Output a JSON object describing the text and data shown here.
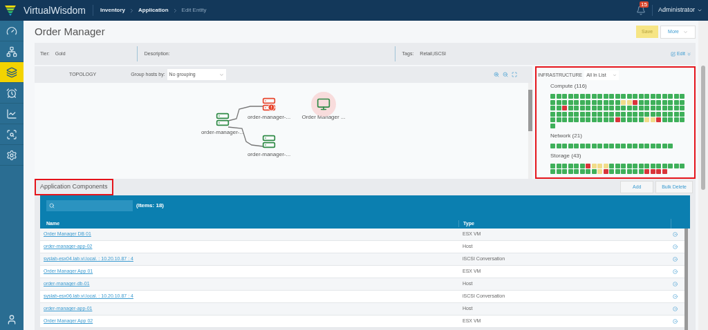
{
  "header": {
    "brand": "VirtualWisdom",
    "breadcrumb": [
      {
        "label": "Inventory",
        "current": false
      },
      {
        "label": "Application",
        "current": false
      },
      {
        "label": "Edit Entity",
        "current": true
      }
    ],
    "notifications": "15",
    "user": "Administrator"
  },
  "sidebar": {
    "items": [
      {
        "kind": "gauge",
        "selected": false
      },
      {
        "kind": "network",
        "selected": false
      },
      {
        "kind": "layers",
        "selected": true
      },
      {
        "kind": "alarm",
        "selected": false
      },
      {
        "kind": "trend",
        "selected": false
      },
      {
        "kind": "bars",
        "selected": false
      },
      {
        "kind": "settings",
        "selected": false
      }
    ],
    "user": {
      "kind": "user"
    }
  },
  "page": {
    "title": "Order Manager",
    "save": "Save",
    "more": "More"
  },
  "info": {
    "tier_label": "Tier:",
    "tier": "Gold",
    "description_label": "Description:",
    "tags_label": "Tags:",
    "tags": "Retail,iSCSI",
    "edit": "Edit"
  },
  "topology": {
    "title": "TOPOLOGY",
    "group_label": "Group hosts by:",
    "group_value": "No grouping",
    "nodes": [
      {
        "kind": "server",
        "color": "#2e8a45",
        "alert": false,
        "label": "order-manager-..."
      },
      {
        "kind": "server",
        "color": "#e8452c",
        "alert": true,
        "label": "order-manager-..."
      },
      {
        "kind": "server",
        "color": "#2e8a45",
        "alert": false,
        "label": "order-manager-..."
      },
      {
        "kind": "monitor",
        "color": "#2e8a45",
        "alert": false,
        "label": "Order Manager ..."
      }
    ]
  },
  "infrastructure": {
    "title": "INFRASTRUCTURE",
    "filter": "All In List",
    "groups": [
      {
        "name": "Compute (116)",
        "tiles": [
          {
            "color": "#3fb05a"
          },
          {
            "color": "#3fb05a"
          },
          {
            "color": "#3fb05a"
          },
          {
            "color": "#3fb05a"
          },
          {
            "color": "#3fb05a"
          },
          {
            "color": "#3fb05a"
          },
          {
            "color": "#3fb05a"
          },
          {
            "color": "#3fb05a"
          },
          {
            "color": "#3fb05a"
          },
          {
            "color": "#3fb05a"
          },
          {
            "color": "#3fb05a"
          },
          {
            "color": "#3fb05a"
          },
          {
            "color": "#3fb05a"
          },
          {
            "color": "#3fb05a"
          },
          {
            "color": "#3fb05a"
          },
          {
            "color": "#3fb05a"
          },
          {
            "color": "#3fb05a"
          },
          {
            "color": "#3fb05a"
          },
          {
            "color": "#3fb05a"
          },
          {
            "color": "#3fb05a"
          },
          {
            "color": "#3fb05a"
          },
          {
            "color": "#3fb05a"
          },
          {
            "color": "#3fb05a"
          },
          {
            "color": "#3fb05a"
          },
          {
            "color": "#3fb05a"
          },
          {
            "color": "#3fb05a"
          },
          {
            "color": "#3fb05a"
          },
          {
            "color": "#3fb05a"
          },
          {
            "color": "#3fb05a"
          },
          {
            "color": "#3fb05a"
          },
          {
            "color": "#3fb05a"
          },
          {
            "color": "#3fb05a"
          },
          {
            "color": "#3fb05a"
          },
          {
            "color": "#3fb05a"
          },
          {
            "color": "#3fb05a"
          },
          {
            "color": "#f1dc8a"
          },
          {
            "color": "#f1dc8a"
          },
          {
            "color": "#d9343a"
          },
          {
            "color": "#3fb05a"
          },
          {
            "color": "#3fb05a"
          },
          {
            "color": "#3fb05a"
          },
          {
            "color": "#3fb05a"
          },
          {
            "color": "#3fb05a"
          },
          {
            "color": "#3fb05a"
          },
          {
            "color": "#3fb05a"
          },
          {
            "color": "#3fb05a"
          },
          {
            "color": "#3fb05a"
          },
          {
            "color": "#3fb05a"
          },
          {
            "color": "#d9343a"
          },
          {
            "color": "#3fb05a"
          },
          {
            "color": "#3fb05a"
          },
          {
            "color": "#3fb05a"
          },
          {
            "color": "#3fb05a"
          },
          {
            "color": "#3fb05a"
          },
          {
            "color": "#3fb05a"
          },
          {
            "color": "#3fb05a"
          },
          {
            "color": "#3fb05a"
          },
          {
            "color": "#3fb05a"
          },
          {
            "color": "#3fb05a"
          },
          {
            "color": "#3fb05a"
          },
          {
            "color": "#3fb05a"
          },
          {
            "color": "#3fb05a"
          },
          {
            "color": "#3fb05a"
          },
          {
            "color": "#3fb05a"
          },
          {
            "color": "#3fb05a"
          },
          {
            "color": "#3fb05a"
          },
          {
            "color": "#3fb05a"
          },
          {
            "color": "#3fb05a"
          },
          {
            "color": "#3fb05a"
          },
          {
            "color": "#3fb05a"
          },
          {
            "color": "#3fb05a"
          },
          {
            "color": "#3fb05a"
          },
          {
            "color": "#3fb05a"
          },
          {
            "color": "#3fb05a"
          },
          {
            "color": "#3fb05a"
          },
          {
            "color": "#3fb05a"
          },
          {
            "color": "#3fb05a"
          },
          {
            "color": "#3fb05a"
          },
          {
            "color": "#3fb05a"
          },
          {
            "color": "#3fb05a"
          },
          {
            "color": "#3fb05a"
          },
          {
            "color": "#3fb05a"
          },
          {
            "color": "#3fb05a"
          },
          {
            "color": "#3fb05a"
          },
          {
            "color": "#3fb05a"
          },
          {
            "color": "#3fb05a"
          },
          {
            "color": "#3fb05a"
          },
          {
            "color": "#3fb05a"
          },
          {
            "color": "#3fb05a"
          },
          {
            "color": "#3fb05a"
          },
          {
            "color": "#3fb05a"
          },
          {
            "color": "#3fb05a"
          },
          {
            "color": "#3fb05a"
          },
          {
            "color": "#3fb05a"
          },
          {
            "color": "#3fb05a"
          },
          {
            "color": "#3fb05a"
          },
          {
            "color": "#3fb05a"
          },
          {
            "color": "#3fb05a"
          },
          {
            "color": "#3fb05a"
          },
          {
            "color": "#3fb05a"
          },
          {
            "color": "#3fb05a"
          },
          {
            "color": "#3fb05a"
          },
          {
            "color": "#3fb05a"
          },
          {
            "color": "#d9343a"
          },
          {
            "color": "#3fb05a"
          },
          {
            "color": "#3fb05a"
          },
          {
            "color": "#3fb05a"
          },
          {
            "color": "#3fb05a"
          },
          {
            "color": "#f1dc8a"
          },
          {
            "color": "#f1dc8a"
          },
          {
            "color": "#d9343a"
          },
          {
            "color": "#3fb05a"
          },
          {
            "color": "#3fb05a"
          },
          {
            "color": "#3fb05a"
          },
          {
            "color": "#3fb05a"
          },
          {
            "color": "#3fb05a"
          }
        ]
      },
      {
        "name": "Network (21)",
        "tiles": [
          {
            "color": "#3fb05a"
          },
          {
            "color": "#3fb05a"
          },
          {
            "color": "#3fb05a"
          },
          {
            "color": "#3fb05a"
          },
          {
            "color": "#3fb05a"
          },
          {
            "color": "#3fb05a"
          },
          {
            "color": "#3fb05a"
          },
          {
            "color": "#3fb05a"
          },
          {
            "color": "#3fb05a"
          },
          {
            "color": "#3fb05a"
          },
          {
            "color": "#3fb05a"
          },
          {
            "color": "#3fb05a"
          },
          {
            "color": "#3fb05a"
          },
          {
            "color": "#3fb05a"
          },
          {
            "color": "#3fb05a"
          },
          {
            "color": "#3fb05a"
          },
          {
            "color": "#3fb05a"
          },
          {
            "color": "#3fb05a"
          },
          {
            "color": "#3fb05a"
          },
          {
            "color": "#3fb05a"
          },
          {
            "color": "#3fb05a"
          }
        ]
      },
      {
        "name": "Storage (43)",
        "tiles": [
          {
            "color": "#3fb05a"
          },
          {
            "color": "#3fb05a"
          },
          {
            "color": "#3fb05a"
          },
          {
            "color": "#3fb05a"
          },
          {
            "color": "#3fb05a"
          },
          {
            "color": "#3fb05a"
          },
          {
            "color": "#d9343a"
          },
          {
            "color": "#f1dc8a"
          },
          {
            "color": "#f1dc8a"
          },
          {
            "color": "#f1dc8a"
          },
          {
            "color": "#3fb05a"
          },
          {
            "color": "#3fb05a"
          },
          {
            "color": "#3fb05a"
          },
          {
            "color": "#3fb05a"
          },
          {
            "color": "#3fb05a"
          },
          {
            "color": "#3fb05a"
          },
          {
            "color": "#3fb05a"
          },
          {
            "color": "#3fb05a"
          },
          {
            "color": "#3fb05a"
          },
          {
            "color": "#3fb05a"
          },
          {
            "color": "#3fb05a"
          },
          {
            "color": "#3fb05a"
          },
          {
            "color": "#3fb05a"
          },
          {
            "color": "#3fb05a"
          },
          {
            "color": "#3fb05a"
          },
          {
            "color": "#3fb05a"
          },
          {
            "color": "#3fb05a"
          },
          {
            "color": "#3fb05a"
          },
          {
            "color": "#3fb05a"
          },
          {
            "color": "#3fb05a"
          },
          {
            "color": "#3fb05a"
          },
          {
            "color": "#f1dc8a"
          },
          {
            "color": "#d9343a"
          },
          {
            "color": "#3fb05a"
          },
          {
            "color": "#3fb05a"
          },
          {
            "color": "#3fb05a"
          },
          {
            "color": "#3fb05a"
          },
          {
            "color": "#3fb05a"
          },
          {
            "color": "#3fb05a"
          },
          {
            "color": "#d9343a"
          },
          {
            "color": "#d9343a"
          },
          {
            "color": "#d9343a"
          },
          {
            "color": "#d9343a"
          }
        ]
      }
    ]
  },
  "components": {
    "title": "Application Components",
    "add": "Add",
    "bulk_delete": "Bulk Delete",
    "count": "(Items: 18)",
    "columns": [
      "Name",
      "Type"
    ],
    "rows": [
      {
        "name": "Order Manager DB 01",
        "type": "ESX VM"
      },
      {
        "name": "order-manager-app-02",
        "type": "Host"
      },
      {
        "name": "syslab-esx04.lab.vi.local. : 10.20.10.87 : 4",
        "type": "iSCSI Conversation"
      },
      {
        "name": "Order Manager App 01",
        "type": "ESX VM"
      },
      {
        "name": "order-manager-db-01",
        "type": "Host"
      },
      {
        "name": "syslab-esx06.lab.vi.local. : 10.20.10.87 : 4",
        "type": "iSCSI Conversation"
      },
      {
        "name": "order-manager-app-01",
        "type": "Host"
      },
      {
        "name": "Order Manager App 02",
        "type": "ESX VM"
      }
    ]
  }
}
